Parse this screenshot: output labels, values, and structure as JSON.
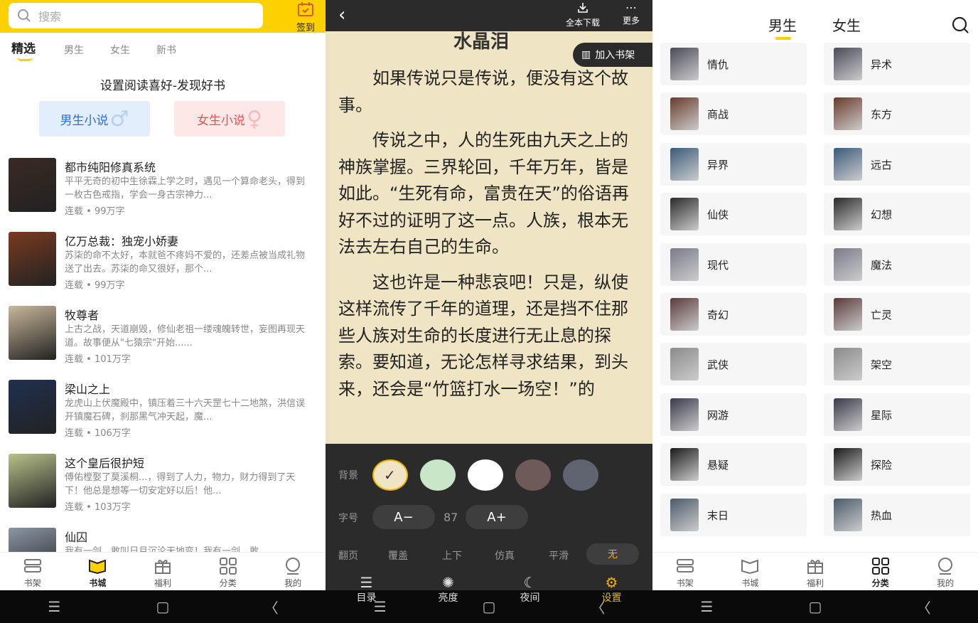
{
  "panel1": {
    "search_placeholder": "搜索",
    "sign_label": "签到",
    "tabs": [
      "精选",
      "男生",
      "女生",
      "新书"
    ],
    "preference_title": "设置阅读喜好-发现好书",
    "male_btn": "男生小说",
    "female_btn": "女生小说",
    "books": [
      {
        "title": "都市纯阳修真系统",
        "desc": "平平无奇的初中生徐霖上学之时，遇见一个算命老头，得到一枚古色戒指，学会一身古宗神力...",
        "status": "连载",
        "words": "99万字",
        "cover": "#3a2a22"
      },
      {
        "title": "亿万总裁：独宠小娇妻",
        "desc": "苏柒的命不太好，本就爸不疼妈不爱的，还差点被当成礼物送了出去。苏柒的命又很好，那个...",
        "status": "连载",
        "words": "99万字",
        "cover": "#7a3a20"
      },
      {
        "title": "牧尊者",
        "desc": "上古之战，天道崩毁，修仙老祖一缕魂魄转世，妄图再现天道。故事便从\"七猿宗\"开始......",
        "status": "连载",
        "words": "101万字",
        "cover": "#c8b79a"
      },
      {
        "title": "梁山之上",
        "desc": "龙虎山上伏魔殿中，镇压着三十六天罡七十二地煞，洪信误开镇魔石碑，刹那黑气冲天起，魔...",
        "status": "连载",
        "words": "106万字",
        "cover": "#203050"
      },
      {
        "title": "这个皇后很护短",
        "desc": "傅佑樘娶了莫溪桐...，得到了人力，物力，财力得到了天下！他总是想等一切安定好以后！他...",
        "status": "连载",
        "words": "103万字",
        "cover": "#b8c08a"
      },
      {
        "title": "仙囚",
        "desc": "我有一剑，敢叫日月沉沦天地变！我有一剑，敢...",
        "status": "",
        "words": "",
        "cover": "#8a96a6"
      }
    ],
    "nav": [
      {
        "label": "书架",
        "icon": "bookshelf-icon"
      },
      {
        "label": "书城",
        "icon": "bookstore-icon"
      },
      {
        "label": "福利",
        "icon": "gift-icon"
      },
      {
        "label": "分类",
        "icon": "category-icon"
      },
      {
        "label": "我的",
        "icon": "profile-icon"
      }
    ]
  },
  "panel2": {
    "download_label": "全本下载",
    "more_label": "更多",
    "chapter_title": "水晶泪",
    "add_shelf": "加入书架",
    "paragraphs": [
      "如果传说只是传说，便没有这个故事。",
      "传说之中，人的生死由九天之上的神族掌握。三界轮回，千年万年，皆是如此。“生死有命，富贵在天”的俗语再好不过的证明了这一点。人族，根本无法去左右自己的生命。",
      "这也许是一种悲哀吧！只是，纵使这样流传了千年的道理，还是挡不住那些人族对生命的长度进行无止息的探索。要知道，无论怎样寻求结果，到头来，还会是“竹篮打水一场空！”的"
    ],
    "background_label": "背景",
    "backgrounds": [
      "#efe4c3",
      "#c9e6c9",
      "#ffffff",
      "#6e5a58",
      "#5f6470"
    ],
    "fontsize_label": "字号",
    "fontsize_minus": "A−",
    "fontsize_value": "87",
    "fontsize_plus": "A+",
    "pageturn_label": "翻页",
    "pageturn_options": [
      "覆盖",
      "上下",
      "仿真",
      "平滑",
      "无"
    ],
    "nav": [
      {
        "label": "目录",
        "icon": "list-icon"
      },
      {
        "label": "亮度",
        "icon": "brightness-icon"
      },
      {
        "label": "夜间",
        "icon": "moon-icon"
      },
      {
        "label": "设置",
        "icon": "settings-icon"
      }
    ]
  },
  "panel3": {
    "tabs": [
      "男生",
      "女生"
    ],
    "male_cats": [
      "情仇",
      "商战",
      "异界",
      "仙侠",
      "现代",
      "奇幻",
      "武侠",
      "网游",
      "悬疑",
      "末日"
    ],
    "female_cats": [
      "异术",
      "东方",
      "远古",
      "幻想",
      "魔法",
      "亡灵",
      "架空",
      "星际",
      "探险",
      "热血"
    ],
    "nav": [
      {
        "label": "书架",
        "icon": "bookshelf-icon"
      },
      {
        "label": "书城",
        "icon": "bookstore-icon"
      },
      {
        "label": "福利",
        "icon": "gift-icon"
      },
      {
        "label": "分类",
        "icon": "category-icon"
      },
      {
        "label": "我的",
        "icon": "profile-icon"
      }
    ]
  },
  "colors": {
    "accent": "#fdd000",
    "reader_bg": "#efe4c3",
    "active_setting": "#f0b400"
  }
}
